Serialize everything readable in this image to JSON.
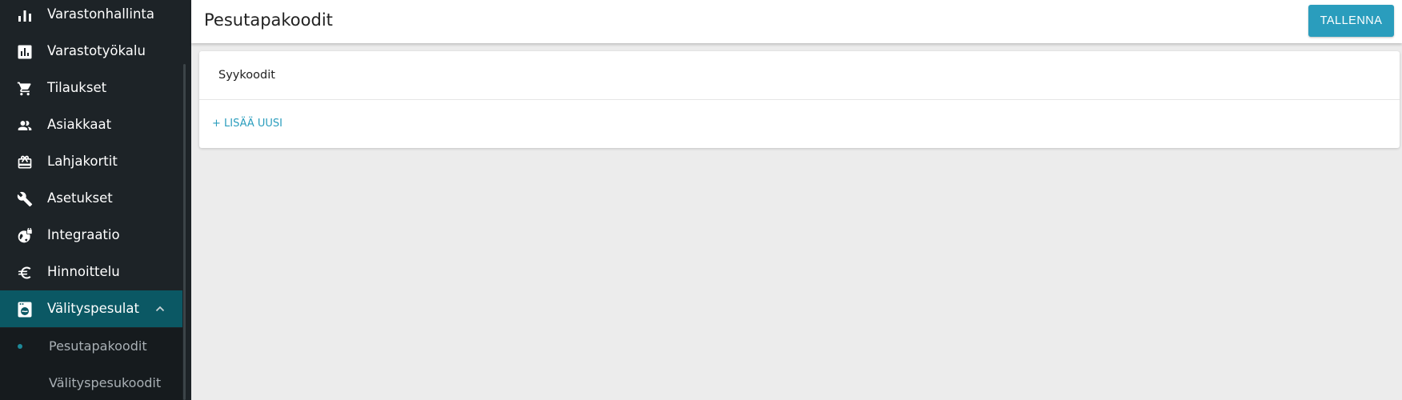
{
  "sidebar": {
    "items": [
      {
        "label": "Varastonhallinta",
        "icon": "bar-chart-icon"
      },
      {
        "label": "Varastotyökalu",
        "icon": "chart-box-icon"
      },
      {
        "label": "Tilaukset",
        "icon": "cart-icon"
      },
      {
        "label": "Asiakkaat",
        "icon": "people-icon"
      },
      {
        "label": "Lahjakortit",
        "icon": "gift-card-icon"
      },
      {
        "label": "Asetukset",
        "icon": "wrench-icon"
      },
      {
        "label": "Integraatio",
        "icon": "globe-lock-icon"
      },
      {
        "label": "Hinnoittelu",
        "icon": "euro-icon"
      },
      {
        "label": "Välityspesulat",
        "icon": "washing-machine-icon",
        "active": true
      }
    ],
    "subitems": [
      {
        "label": "Pesutapakoodit",
        "active": true
      },
      {
        "label": "Välityspesukoodit"
      }
    ]
  },
  "header": {
    "title": "Pesutapakoodit",
    "save_label": "TALLENNA"
  },
  "card": {
    "title": "Syykoodit",
    "add_label": "+ LISÄÄ UUSI"
  },
  "colors": {
    "sidebar_bg": "#1d2327",
    "active_bg": "#0b5864",
    "accent": "#2a9dbd",
    "content_bg": "#ececec"
  }
}
